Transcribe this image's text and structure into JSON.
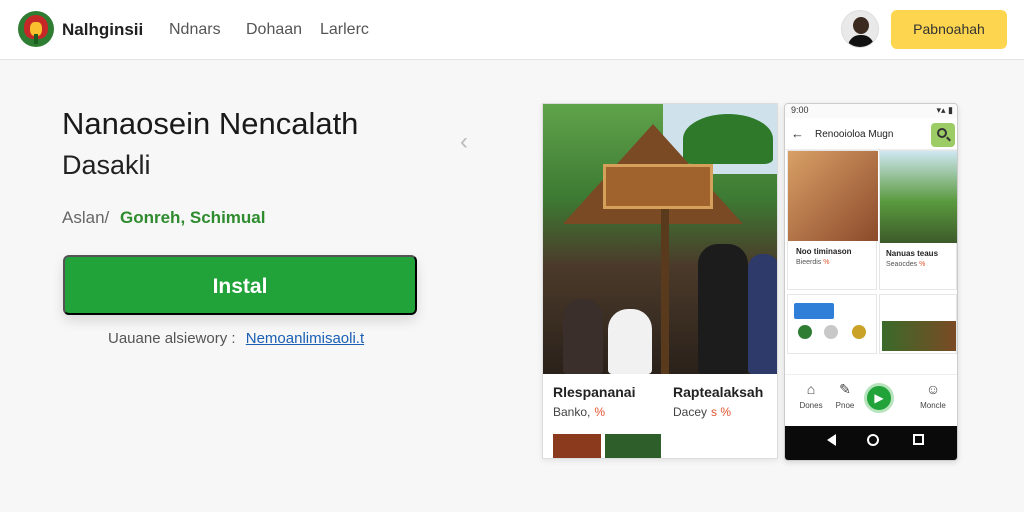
{
  "header": {
    "app_name": "Nalhginsii",
    "nav": [
      "Ndnars",
      "Dohaan",
      "Larlerc"
    ],
    "cta_label": "Pabnoahah"
  },
  "hero": {
    "title": "Nanaosein Nencalath",
    "subtitle": "Dasakli",
    "rating_label": "Aslan",
    "rating_sep": "/",
    "rating_value": "Gonreh, Schimual",
    "install_label": "Instal",
    "compat_label": "Uauane alsiewory :",
    "compat_link": "Nemoanlimisaoli.t"
  },
  "screenshots": {
    "card1": {
      "caption_a_title": "Rlespananai",
      "caption_a_sub": "Banko,",
      "caption_a_highlight": "%",
      "caption_b_title": "Raptealaksah",
      "caption_b_sub": "Dacey",
      "caption_b_highlight": "s %"
    },
    "phone": {
      "status_left": "9:00",
      "status_right": "▾▴ ▮",
      "title": "Renooioloa Mugn",
      "tile1_title": "Noo timinason",
      "tile1_sub": "Bieerdis",
      "tile1_highlight": "%",
      "tile2_title": "Nanuas teaus",
      "tile2_sub": "Seaocdes",
      "tile2_highlight": "%",
      "tile3_title": "",
      "tile4_title": "",
      "tabs": [
        "Dones",
        "Pnoe",
        "",
        "Moncle"
      ]
    }
  },
  "colors": {
    "install": "#21a33a",
    "cta": "#fdd54e",
    "rating_value": "#2e8b2e",
    "link": "#1a5fb4"
  }
}
